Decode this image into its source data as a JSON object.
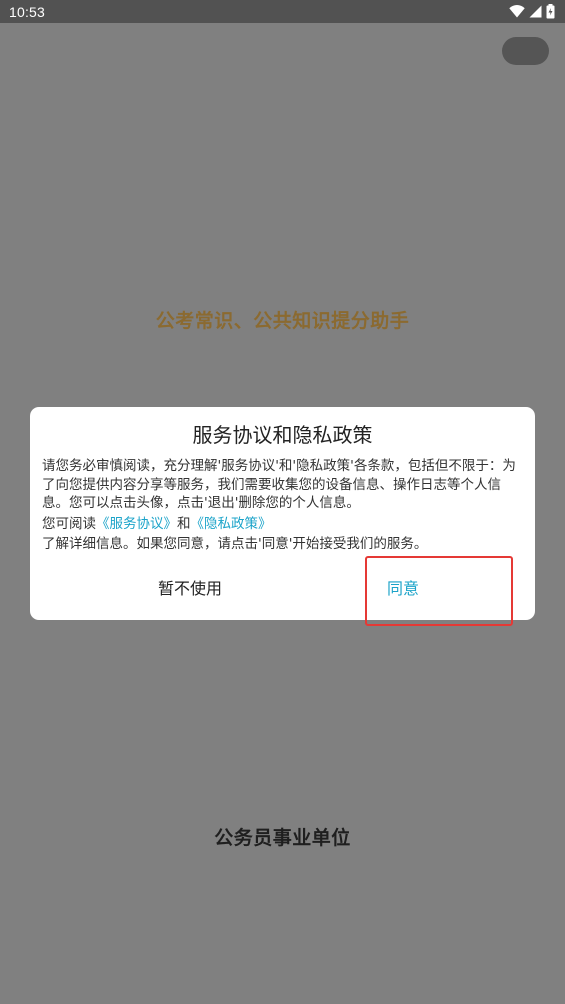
{
  "status_bar": {
    "time": "10:53",
    "icons": [
      "wifi-icon",
      "signal-icon",
      "battery-icon"
    ]
  },
  "splash": {
    "slogan": "公考常识、公共知识提分助手",
    "company": "公务员事业单位"
  },
  "dialog": {
    "title": "服务协议和隐私政策",
    "paragraph1": "请您务必审慎阅读，充分理解'服务协议'和'隐私政策'各条款，包括但不限于：为了向您提供内容分享等服务，我们需要收集您的设备信息、操作日志等个人信息。您可以点击头像，点击'退出'删除您的个人信息。",
    "read_prefix": "您可阅读",
    "service_link": "《服务协议》",
    "and_word": "和",
    "privacy_link": "《隐私政策》",
    "paragraph3": "了解详细信息。如果您同意，请点击'同意'开始接受我们的服务。",
    "decline_label": "暂不使用",
    "agree_label": "同意"
  },
  "colors": {
    "background": "#808080",
    "status_bar": "#525252",
    "slogan": "#8b6a30",
    "link": "#1ba3c9",
    "highlight": "#e53935"
  }
}
